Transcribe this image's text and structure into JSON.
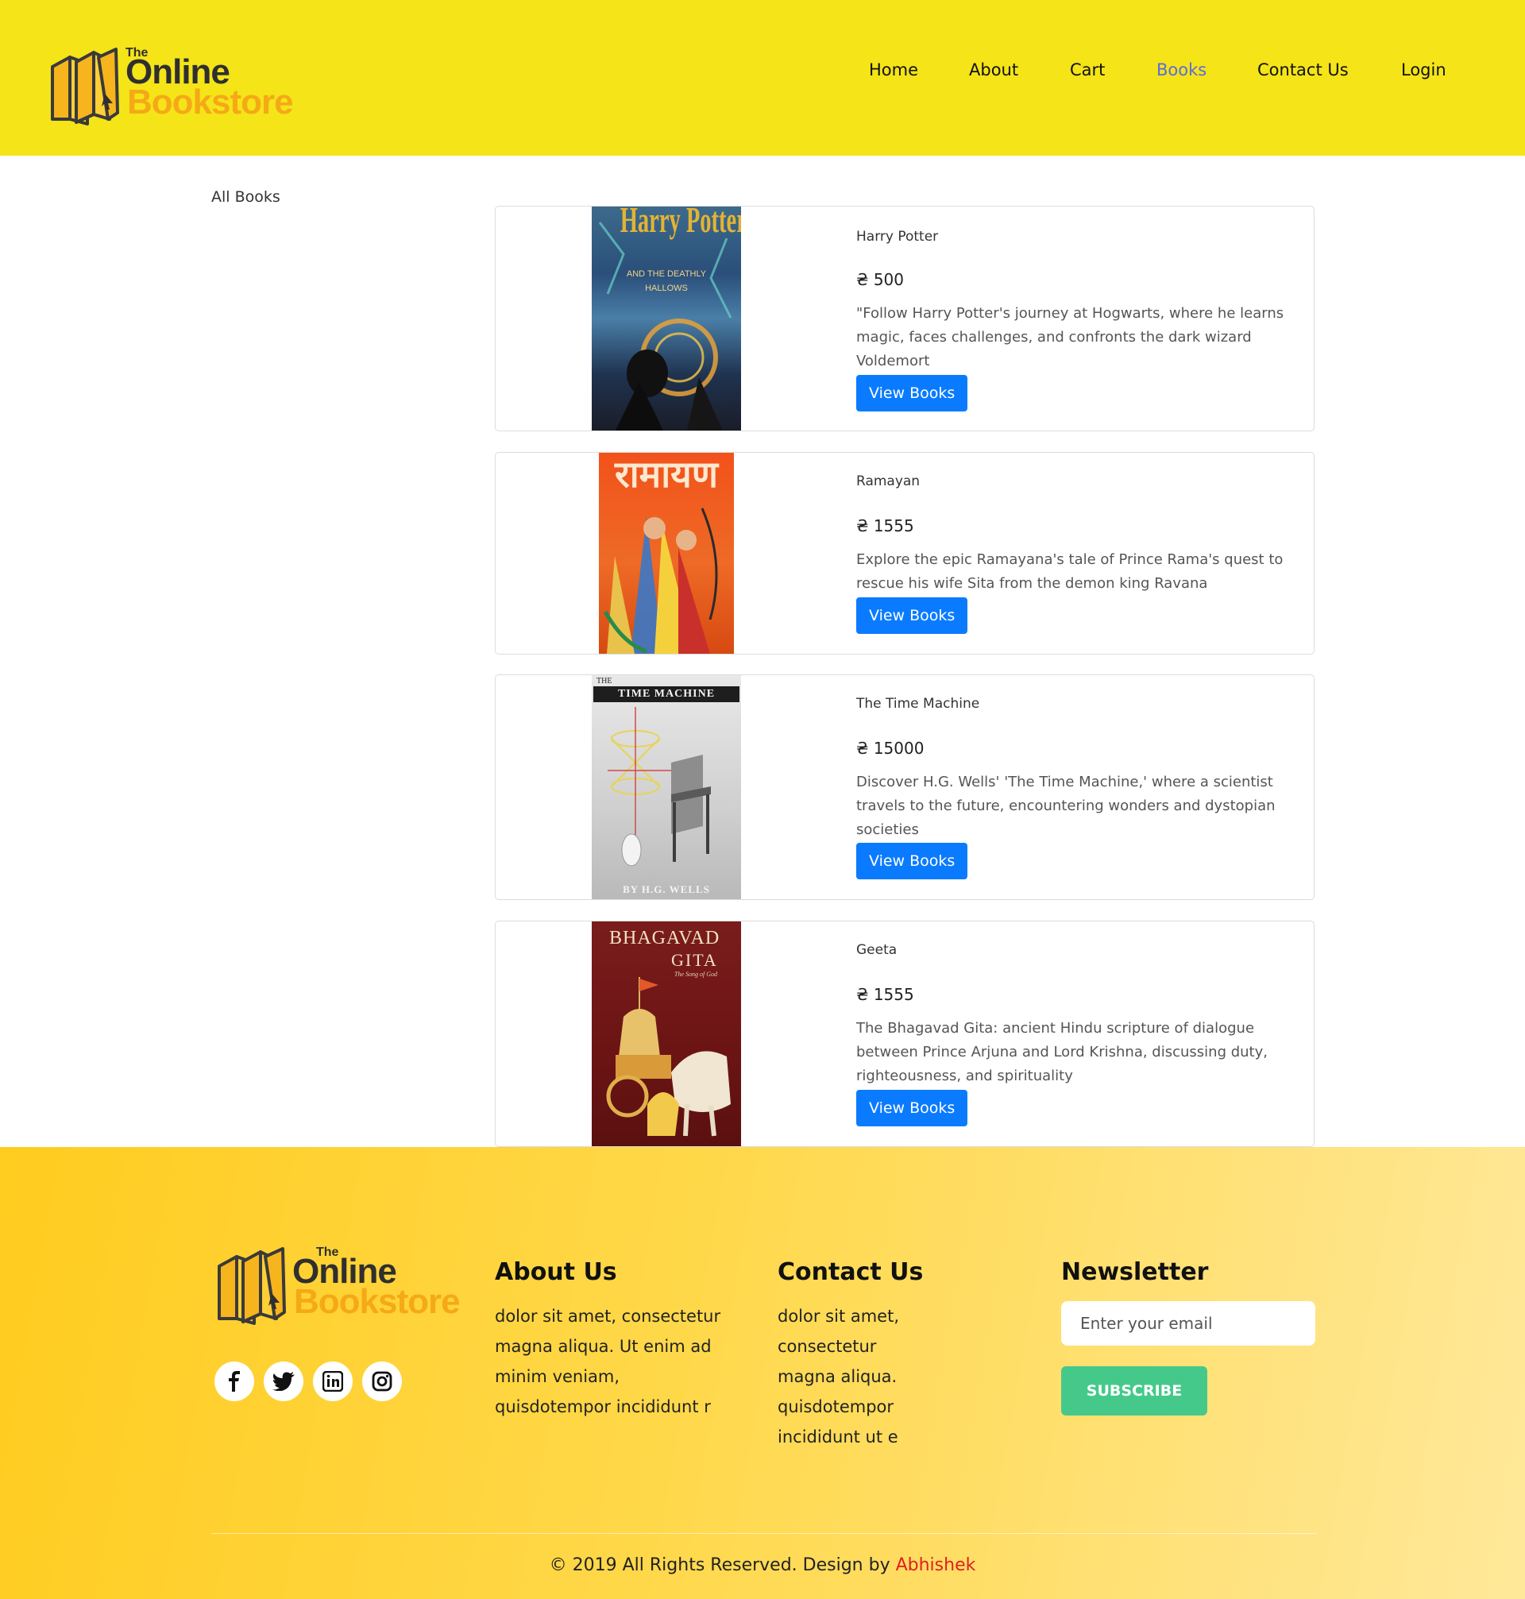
{
  "brand": {
    "logo_the": "The",
    "logo_online": "Online",
    "logo_bookstore": "Bookstore"
  },
  "nav": {
    "home": "Home",
    "about": "About",
    "cart": "Cart",
    "books": "Books",
    "contact": "Contact Us",
    "login": "Login",
    "active": "books",
    "active_color": "#5a6adf"
  },
  "main": {
    "heading": "All Books",
    "books": [
      {
        "title": "Harry Potter",
        "price": "₴ 500",
        "description": "\"Follow Harry Potter's journey at Hogwarts, where he learns magic, faces challenges, and confronts the dark wizard Voldemort",
        "button": "View Books",
        "cover_title": "Harry Potter",
        "cover_subtitle": "AND THE DEATHLY HALLOWS"
      },
      {
        "title": "Ramayan",
        "price": "₴ 1555",
        "description": "Explore the epic Ramayana's tale of Prince Rama's quest to rescue his wife Sita from the demon king Ravana",
        "button": "View Books",
        "cover_title": "रामायण"
      },
      {
        "title": "The Time Machine",
        "price": "₴ 15000",
        "description": "Discover H.G. Wells' 'The Time Machine,' where a scientist travels to the future, encountering wonders and dystopian societies",
        "button": "View Books",
        "cover_the": "THE",
        "cover_title": "TIME MACHINE",
        "cover_author": "BY H.G. WELLS"
      },
      {
        "title": "Geeta",
        "price": "₴ 1555",
        "description": "The Bhagavad Gita: ancient Hindu scripture of dialogue between Prince Arjuna and Lord Krishna, discussing duty, righteousness, and spirituality",
        "button": "View Books",
        "cover_title_1": "BHAGAVAD",
        "cover_title_2": "GITA",
        "cover_subtitle": "The Song of God"
      }
    ],
    "button_color": "#0a7bff"
  },
  "footer": {
    "social": [
      "facebook-icon",
      "twitter-icon",
      "linkedin-icon",
      "instagram-icon"
    ],
    "about_title": "About Us",
    "about_lines": [
      "dolor sit amet, consectetur",
      "magna aliqua. Ut enim ad",
      "minim veniam,",
      "quisdotempor incididunt r"
    ],
    "contact_title": "Contact Us",
    "contact_lines": [
      "dolor sit amet,",
      "consectetur",
      "magna aliqua.",
      "quisdotempor",
      "incididunt ut e"
    ],
    "newsletter_title": "Newsletter",
    "email_placeholder": "Enter your email",
    "subscribe_label": "SUBSCRIBE",
    "subscribe_color": "#45c98a",
    "copyright_text": "© 2019 All Rights Reserved. Design by ",
    "copyright_author": "Abhishek"
  }
}
